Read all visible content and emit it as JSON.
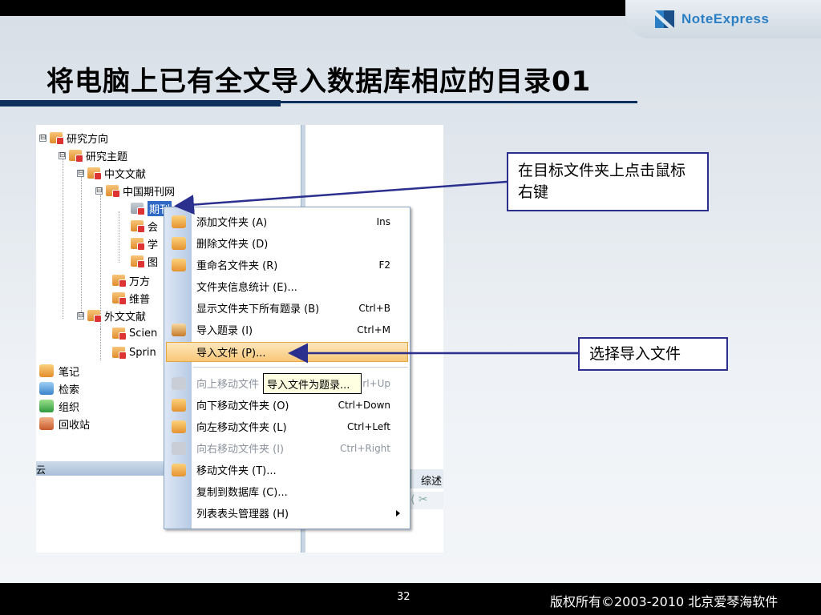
{
  "slide": {
    "title": "将电脑上已有全文导入数据库相应的目录01",
    "logo_text": "NoteExpress",
    "page_number": "32",
    "copyright": "版权所有©2003-2010 北京爱琴海软件"
  },
  "tree": {
    "items": [
      {
        "label": "研究方向",
        "level": 0,
        "expander": "⊟"
      },
      {
        "label": "研究主题",
        "level": 1,
        "expander": "⊟"
      },
      {
        "label": "中文文献",
        "level": 2,
        "expander": "⊟"
      },
      {
        "label": "中国期刊网",
        "level": 3,
        "expander": "⊟"
      },
      {
        "label": "期刊",
        "level": 4,
        "expander": "",
        "selected": true
      },
      {
        "label": "会",
        "level": 4,
        "expander": ""
      },
      {
        "label": "学",
        "level": 4,
        "expander": ""
      },
      {
        "label": "图",
        "level": 4,
        "expander": ""
      },
      {
        "label": "万方",
        "level": 3,
        "expander": ""
      },
      {
        "label": "维普",
        "level": 3,
        "expander": ""
      },
      {
        "label": "外文文献",
        "level": 2,
        "expander": "⊟"
      },
      {
        "label": "Scien",
        "level": 3,
        "expander": ""
      },
      {
        "label": "Sprin",
        "level": 3,
        "expander": ""
      }
    ],
    "bottom_items": [
      {
        "label": "笔记",
        "icon": "note-icon"
      },
      {
        "label": "检索",
        "icon": "search-folder-icon"
      },
      {
        "label": "组织",
        "icon": "organize-icon"
      },
      {
        "label": "回收站",
        "icon": "recycle-bin-icon"
      }
    ],
    "hbar_text": "云",
    "right_tab_text": "综述",
    "right_toolbar_text": "⟨ ✂"
  },
  "context_menu": {
    "items": [
      {
        "label": "添加文件夹 (A)",
        "shortcut": "Ins",
        "icon": "add-folder-icon",
        "disabled": false
      },
      {
        "label": "删除文件夹 (D)",
        "shortcut": "",
        "icon": "delete-folder-icon",
        "disabled": false
      },
      {
        "label": "重命名文件夹 (R)",
        "shortcut": "F2",
        "icon": "rename-folder-icon",
        "disabled": false
      },
      {
        "label": "文件夹信息统计 (E)...",
        "shortcut": "",
        "icon": "",
        "disabled": false
      },
      {
        "label": "显示文件夹下所有题录 (B)",
        "shortcut": "Ctrl+B",
        "icon": "",
        "disabled": false
      },
      {
        "label": "导入题录 (I)",
        "shortcut": "Ctrl+M",
        "icon": "import-records-icon",
        "disabled": false
      },
      {
        "label": "导入文件 (P)...",
        "shortcut": "",
        "icon": "",
        "disabled": false,
        "highlighted": true
      },
      {
        "label": "向上移动文件",
        "shortcut": "rl+Up",
        "icon": "move-up-icon",
        "disabled": true
      },
      {
        "label": "向下移动文件夹 (O)",
        "shortcut": "Ctrl+Down",
        "icon": "move-down-icon",
        "disabled": false
      },
      {
        "label": "向左移动文件夹 (L)",
        "shortcut": "Ctrl+Left",
        "icon": "move-left-icon",
        "disabled": false
      },
      {
        "label": "向右移动文件夹 (I)",
        "shortcut": "Ctrl+Right",
        "icon": "move-right-icon",
        "disabled": true
      },
      {
        "label": "移动文件夹 (T)...",
        "shortcut": "",
        "icon": "move-folder-icon",
        "disabled": false
      },
      {
        "label": "复制到数据库 (C)...",
        "shortcut": "",
        "icon": "",
        "disabled": false
      },
      {
        "label": "列表表头管理器 (H)",
        "shortcut": "",
        "icon": "",
        "disabled": false,
        "submenu": true
      }
    ],
    "tooltip": "导入文件为题录..."
  },
  "callouts": {
    "right_click": "在目标文件夹上点击鼠标右键",
    "select_import": "选择导入文件"
  },
  "colors": {
    "title_rule": "#0f2f5e",
    "callout_border": "#2b2f8e",
    "arrow": "#2b2f8e",
    "selection": "#3169c6",
    "menu_highlight": "#f8c878"
  }
}
